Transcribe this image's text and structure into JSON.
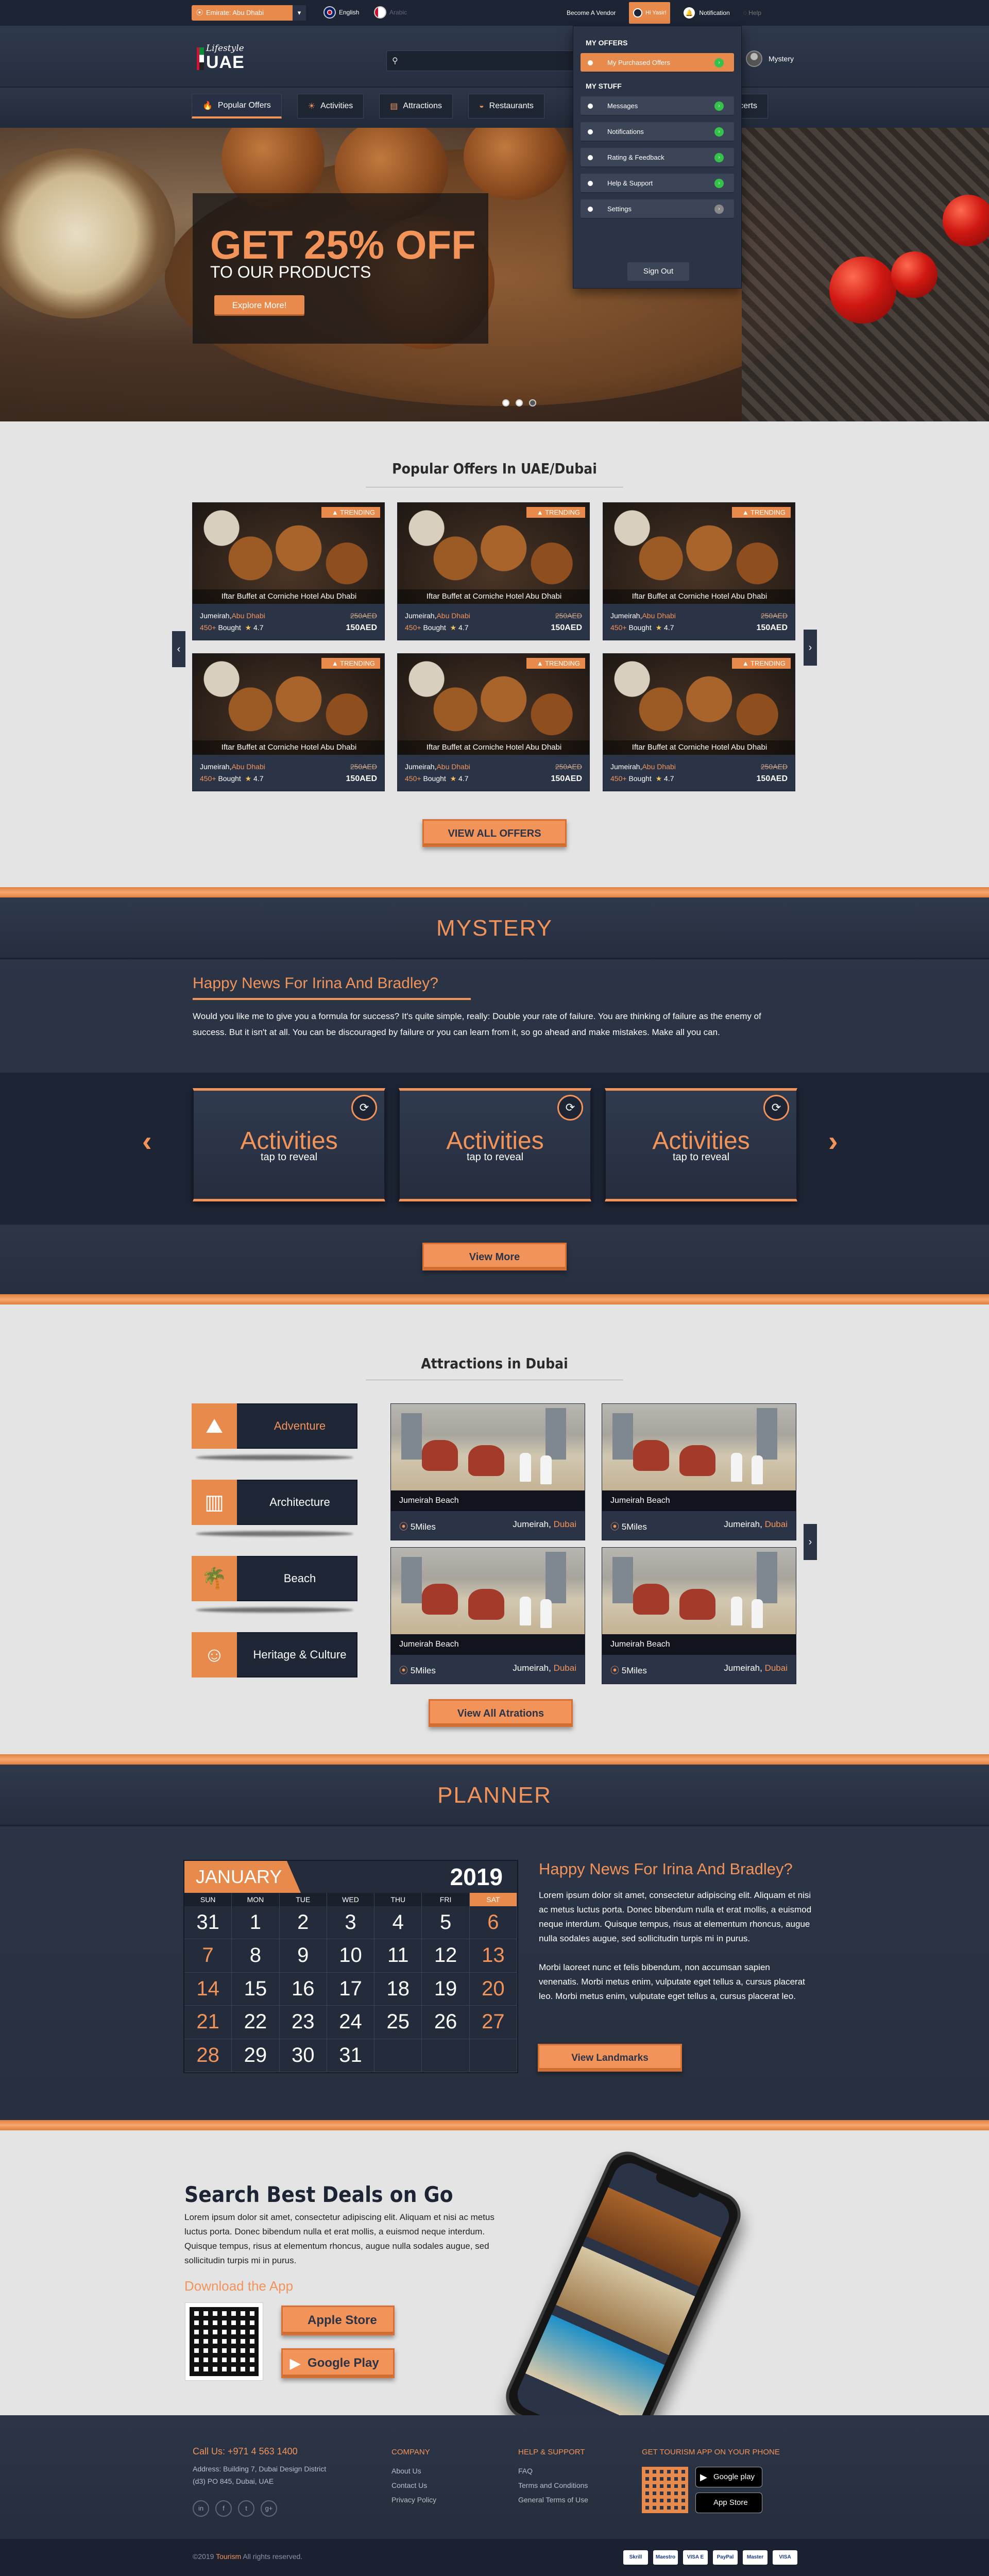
{
  "topbar": {
    "location": "Emirate: Abu Dhabi",
    "lang_en": "English",
    "lang_ar": "Arabic",
    "become_vendor": "Become A Vendor",
    "user": "Hi Yasir!",
    "notification": "Notification",
    "help": "Help"
  },
  "header": {
    "logo_top": "Lifestyle",
    "logo_bottom": "UAE",
    "profile_name": "Mystery"
  },
  "nav": {
    "items": [
      {
        "label": "Popular Offers",
        "icon": "flame-icon"
      },
      {
        "label": "Activities",
        "icon": "sun-icon"
      },
      {
        "label": "Attractions",
        "icon": "ticket-icon"
      },
      {
        "label": "Restaurants",
        "icon": "cloche-icon"
      },
      {
        "label": "Concerts",
        "icon": "music-icon"
      }
    ]
  },
  "hero": {
    "headline": "GET 25% OFF",
    "subline": "TO OUR PRODUCTS",
    "cta": "Explore More!",
    "slides": 3,
    "active_slide": 2
  },
  "dropdown": {
    "offers_heading": "MY OFFERS",
    "offers_items": [
      "My Purchased Offers"
    ],
    "stuff_heading": "MY STUFF",
    "stuff_items": [
      "Messages",
      "Notifications",
      "Rating & Feedback",
      "Help & Support",
      "Settings"
    ],
    "signout": "Sign Out"
  },
  "offers": {
    "title": "Popular Offers In UAE/Dubai",
    "badge": "TRENDING",
    "card_title": "Iftar Buffet at Corniche Hotel Abu Dhabi",
    "location_area": "Jumeirah,",
    "location_city": "Abu Dhabi",
    "bought_count": "450+",
    "bought_label": "Bought",
    "rating": "4.7",
    "old_price": "250AED",
    "price": "150AED",
    "view_all": "VIEW ALL OFFERS"
  },
  "mystery": {
    "title": "MYSTERY",
    "heading": "Happy News For Irina And Bradley?",
    "paragraph": "Would you like me to give you a formula for success? It's quite simple, really: Double your rate of failure. You are thinking of failure as the enemy of success. But it isn't at all. You can be discouraged by failure or you can learn from it, so go ahead and make mistakes. Make all you can.",
    "cards": [
      {
        "title": "Activities",
        "sub": "tap to reveal"
      },
      {
        "title": "Activities",
        "sub": "tap to reveal"
      },
      {
        "title": "Activities",
        "sub": "tap to reveal"
      }
    ],
    "view_more": "View More"
  },
  "attractions": {
    "title": "Attractions in Dubai",
    "categories": [
      {
        "label": "Adventure",
        "icon": "climber-icon",
        "active": true
      },
      {
        "label": "Architecture",
        "icon": "building-icon",
        "active": false
      },
      {
        "label": "Beach",
        "icon": "palm-icon",
        "active": false
      },
      {
        "label": "Heritage & Culture",
        "icon": "masks-icon",
        "active": false
      }
    ],
    "card_name": "Jumeirah Beach",
    "distance": "5Miles",
    "area": "Jumeirah,",
    "city": "Dubai",
    "view_all": "View All Atrations"
  },
  "planner": {
    "title": "PLANNER",
    "month": "JANUARY",
    "year": "2019",
    "weekdays": [
      "SUN",
      "MON",
      "TUE",
      "WED",
      "THU",
      "FRI",
      "SAT"
    ],
    "days": [
      "31",
      "1",
      "2",
      "3",
      "4",
      "5",
      "6",
      "7",
      "8",
      "9",
      "10",
      "11",
      "12",
      "13",
      "14",
      "15",
      "16",
      "17",
      "18",
      "19",
      "20",
      "21",
      "22",
      "23",
      "24",
      "25",
      "26",
      "27",
      "28",
      "29",
      "30",
      "31",
      "",
      "",
      ""
    ],
    "heading": "Happy News For Irina And Bradley?",
    "para1": "Lorem ipsum dolor sit amet, consectetur adipiscing elit. Aliquam et nisi ac metus luctus porta. Donec bibendum nulla et erat mollis, a euismod neque interdum. Quisque tempus, risus at elementum rhoncus, augue nulla sodales augue, sed sollicitudin turpis mi in purus.",
    "para2": "Morbi laoreet nunc et felis bibendum, non accumsan sapien venenatis. Morbi metus enim, vulputate eget tellus a, cursus placerat leo.  Morbi metus enim, vulputate eget tellus a, cursus placerat leo.",
    "cta": "View Landmarks"
  },
  "app": {
    "title": "Search Best Deals on Go",
    "paragraph": "Lorem ipsum dolor sit amet, consectetur adipiscing elit. Aliquam et nisi ac metus luctus porta. Donec bibendum nulla et erat mollis, a euismod neque interdum. Quisque tempus, risus at elementum rhoncus, augue nulla sodales augue, sed sollicitudin turpis mi in purus.",
    "download": "Download the App",
    "apple": "Apple Store",
    "google": "Google Play"
  },
  "footer": {
    "call": "Call Us: +971 4 563 1400",
    "address1": "Address: Building 7, Dubai Design District",
    "address2": "(d3) PO 845, Dubai, UAE",
    "social": [
      "in",
      "f",
      "t",
      "g+"
    ],
    "company_title": "COMPANY",
    "company_links": [
      "About Us",
      "Contact Us",
      "Privacy Policy"
    ],
    "help_title": "HELP & SUPPORT",
    "help_links": [
      "FAQ",
      "Terms and Conditions",
      "General Terms of Use"
    ],
    "get_app": "GET TOURISM APP ON YOUR PHONE",
    "google_badge": "Google play",
    "apple_badge": "App Store",
    "copyright_pre": "©2019",
    "brand": "Tourism",
    "copyright_post": "All rights reserved.",
    "payments": [
      "Skrill",
      "Maestro",
      "VISA E",
      "PayPal",
      "Master",
      "VISA"
    ]
  }
}
